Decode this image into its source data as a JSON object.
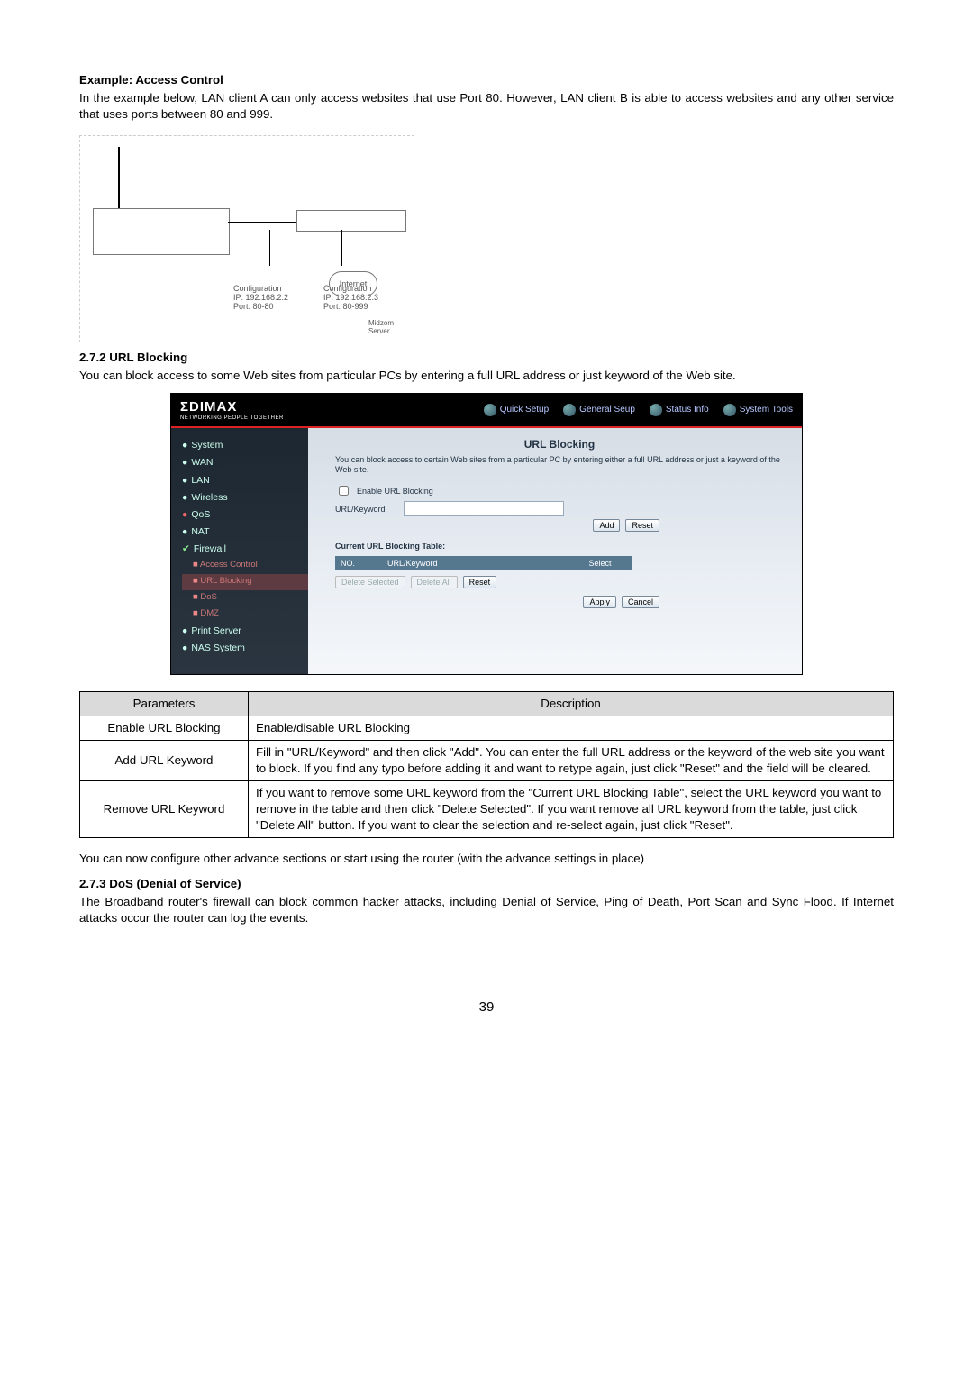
{
  "doc": {
    "example_heading": "Example: Access Control",
    "example_text": "In the example below, LAN client A can only access websites that use Port 80. However, LAN client B is able to access websites and any other service that uses ports between 80 and 999.",
    "section_272_heading": "2.7.2 URL Blocking",
    "section_272_text": "You can block access to some Web sites from particular PCs by entering a full URL address or just keyword of the Web site.",
    "after_table_text": "You can now configure other advance sections or start using the router (with the advance settings in place)",
    "section_273_heading": "2.7.3 DoS (Denial of Service)",
    "section_273_text": "The Broadband router's firewall can block common hacker attacks, including Denial of Service, Ping of Death, Port Scan and Sync Flood. If Internet attacks occur the router can log the events.",
    "page_number": "39"
  },
  "diagram": {
    "config_a_line1": "Configuration",
    "config_a_line2": "IP: 192.168.2.2",
    "config_a_line3": "Port: 80-80",
    "config_b_line1": "Configuration",
    "config_b_line2": "IP: 192.168.2.3",
    "config_b_line3": "Port: 80-999",
    "cloud_label": "Internet",
    "bottom_label1": "Midzom",
    "bottom_label2": "Server"
  },
  "ui": {
    "brand": "ΣDIMAX",
    "brand_sub": "NETWORKING PEOPLE TOGETHER",
    "tabs": {
      "quick_setup": "Quick Setup",
      "general_setup": "General Seup",
      "status_info": "Status Info",
      "system_tools": "System Tools"
    },
    "sidebar": {
      "system": "System",
      "wan": "WAN",
      "lan": "LAN",
      "wireless": "Wireless",
      "qos": "QoS",
      "nat": "NAT",
      "firewall": "Firewall",
      "access_control": "Access Control",
      "url_blocking": "URL Blocking",
      "dos": "DoS",
      "dmz": "DMZ",
      "print_server": "Print Server",
      "nas_system": "NAS System"
    },
    "content": {
      "title": "URL Blocking",
      "desc": "You can block access to certain Web sites from a particular PC by entering either a full URL address or just a keyword of the Web site.",
      "enable_label": "Enable URL Blocking",
      "keyword_label": "URL/Keyword",
      "add_btn": "Add",
      "reset_btn": "Reset",
      "table_label": "Current URL Blocking Table:",
      "th_no": "NO.",
      "th_keyword": "URL/Keyword",
      "th_select": "Select",
      "delete_selected": "Delete Selected",
      "delete_all": "Delete All",
      "reset2": "Reset",
      "apply": "Apply",
      "cancel": "Cancel"
    }
  },
  "params": {
    "head_parameters": "Parameters",
    "head_description": "Description",
    "row1_param": "Enable URL Blocking",
    "row1_desc": "Enable/disable URL Blocking",
    "row2_param": "Add URL Keyword",
    "row2_desc": "Fill in \"URL/Keyword\" and then click \"Add\". You can enter the full URL address or the keyword of the web site you want to block. If you find any typo before adding it and want to retype again, just click \"Reset\" and the field will be cleared.",
    "row3_param": "Remove URL Keyword",
    "row3_desc": "If you want to remove some URL keyword from the \"Current URL Blocking Table\", select the URL keyword you want to remove in the table and then click \"Delete Selected\". If you want remove all URL keyword from the table, just click \"Delete All\" button. If you want to clear the selection and re-select again, just click \"Reset\"."
  }
}
